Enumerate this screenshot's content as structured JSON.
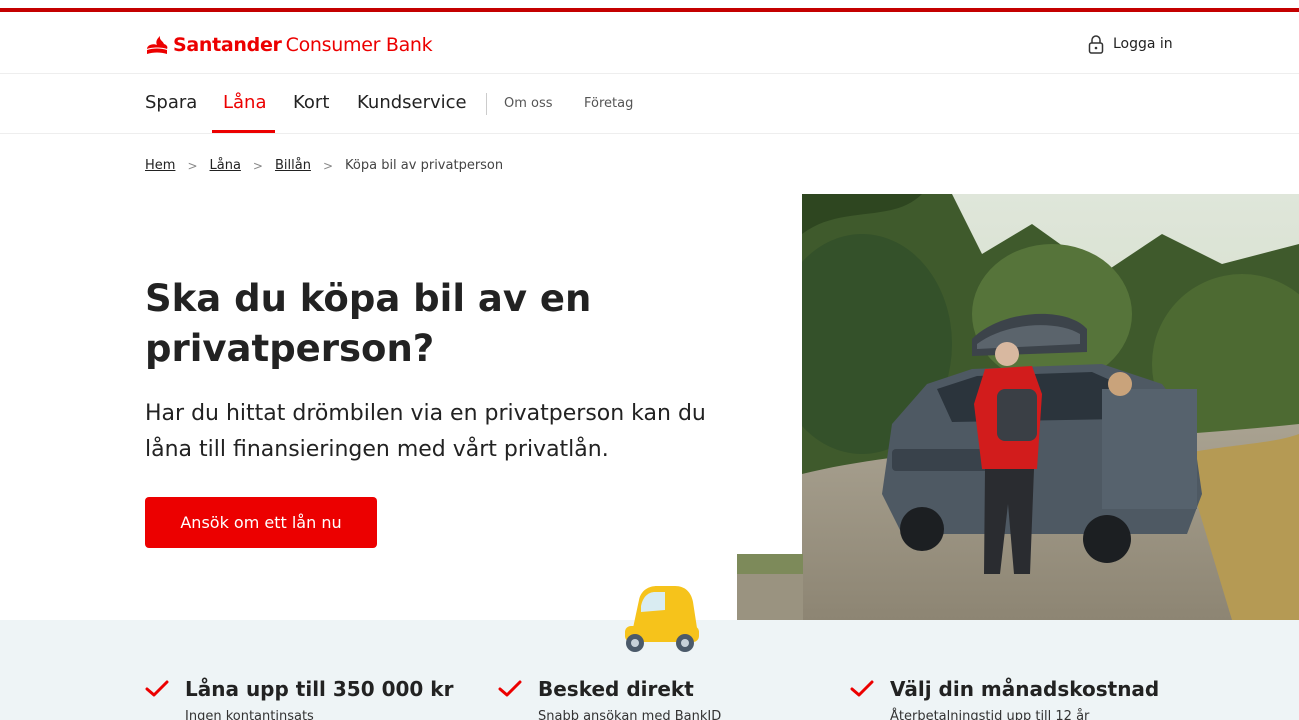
{
  "colors": {
    "brand": "#ec0000",
    "topbar": "#c40000",
    "features_bg": "#eef4f6"
  },
  "header": {
    "logo_brand": "Santander",
    "logo_sub": "Consumer Bank",
    "login_label": "Logga in",
    "login_icon": "lock-icon"
  },
  "nav": {
    "items": [
      {
        "label": "Spara"
      },
      {
        "label": "Låna"
      },
      {
        "label": "Kort"
      },
      {
        "label": "Kundservice"
      }
    ],
    "secondary": [
      {
        "label": "Om oss"
      },
      {
        "label": "Företag"
      }
    ]
  },
  "breadcrumb": {
    "items": [
      {
        "label": "Hem"
      },
      {
        "label": "Låna"
      },
      {
        "label": "Billån"
      }
    ],
    "current": "Köpa bil av privatperson",
    "separator": ">"
  },
  "hero": {
    "title": "Ska du köpa bil av en privatperson?",
    "text": "Har du hittat drömbilen via en privatperson kan du låna till finansieringen med vårt privatlån.",
    "cta_label": "Ansök om ett lån nu"
  },
  "features": [
    {
      "title": "Låna upp till 350 000 kr",
      "subtitle": "Ingen kontantinsats"
    },
    {
      "title": "Besked direkt",
      "subtitle": "Snabb ansökan med BankID"
    },
    {
      "title": "Välj din månadskostnad",
      "subtitle": "Återbetalningstid upp till 12 år"
    }
  ]
}
